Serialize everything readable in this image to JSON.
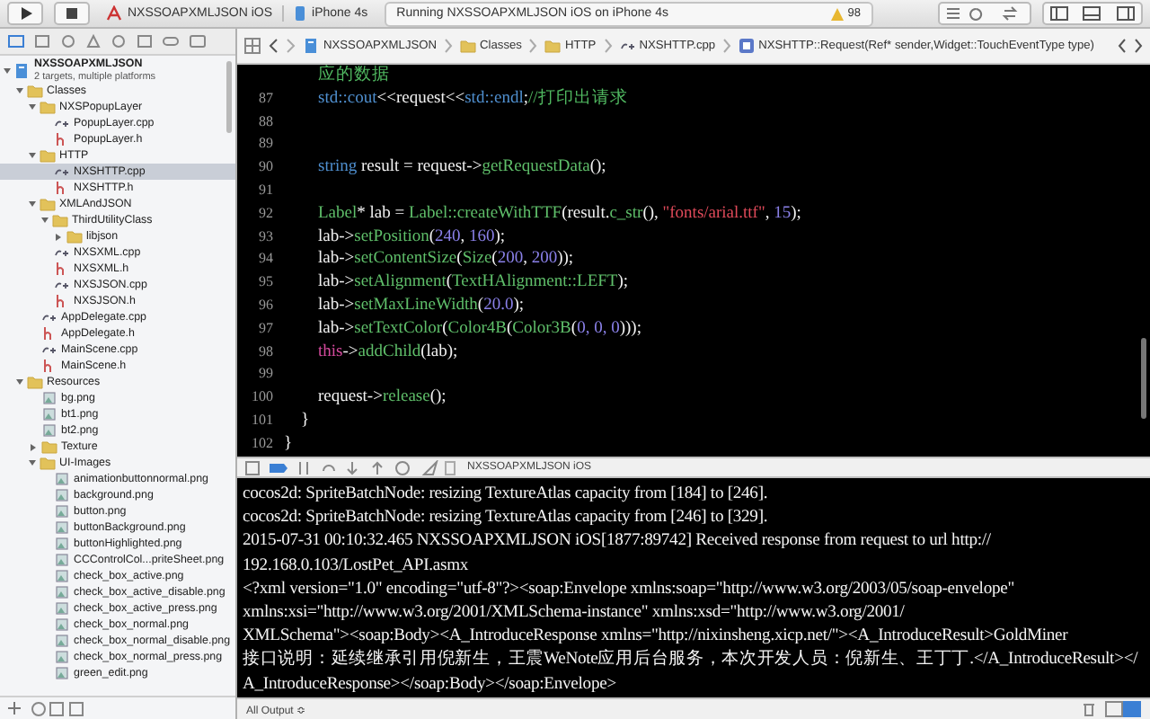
{
  "toolbar": {
    "scheme": "NXSSOAPXMLJSON iOS",
    "device": "iPhone 4s",
    "status": "Running NXSSOAPXMLJSON iOS on iPhone 4s",
    "warnings": "98"
  },
  "navigator": {
    "tree": [
      {
        "label": "NXSSOAPXMLJSON",
        "subtitle": "2 targets, multiple platforms",
        "kind": "project",
        "expanded": true,
        "selected": false,
        "children": [
          {
            "label": "Classes",
            "kind": "folder",
            "expanded": true,
            "selected": false,
            "children": [
              {
                "label": "NXSPopupLayer",
                "kind": "folder",
                "expanded": true,
                "selected": false,
                "children": [
                  {
                    "label": "PopupLayer.cpp",
                    "kind": "cpp",
                    "selected": false
                  },
                  {
                    "label": "PopupLayer.h",
                    "kind": "h",
                    "selected": false
                  }
                ]
              },
              {
                "label": "HTTP",
                "kind": "folder",
                "expanded": true,
                "selected": false,
                "children": [
                  {
                    "label": "NXSHTTP.cpp",
                    "kind": "cpp",
                    "selected": true
                  },
                  {
                    "label": "NXSHTTP.h",
                    "kind": "h",
                    "selected": false
                  }
                ]
              },
              {
                "label": "XMLAndJSON",
                "kind": "folder",
                "expanded": true,
                "selected": false,
                "children": [
                  {
                    "label": "ThirdUtilityClass",
                    "kind": "folder",
                    "expanded": true,
                    "selected": false,
                    "children": [
                      {
                        "label": "libjson",
                        "kind": "folder",
                        "expanded": false,
                        "selected": false
                      }
                    ]
                  },
                  {
                    "label": "NXSXML.cpp",
                    "kind": "cpp",
                    "selected": false
                  },
                  {
                    "label": "NXSXML.h",
                    "kind": "h",
                    "selected": false
                  },
                  {
                    "label": "NXSJSON.cpp",
                    "kind": "cpp",
                    "selected": false
                  },
                  {
                    "label": "NXSJSON.h",
                    "kind": "h",
                    "selected": false
                  }
                ]
              },
              {
                "label": "AppDelegate.cpp",
                "kind": "cpp",
                "selected": false
              },
              {
                "label": "AppDelegate.h",
                "kind": "h",
                "selected": false
              },
              {
                "label": "MainScene.cpp",
                "kind": "cpp",
                "selected": false
              },
              {
                "label": "MainScene.h",
                "kind": "h",
                "selected": false
              }
            ]
          },
          {
            "label": "Resources",
            "kind": "folder",
            "expanded": true,
            "selected": false,
            "children": [
              {
                "label": "bg.png",
                "kind": "png",
                "selected": false
              },
              {
                "label": "bt1.png",
                "kind": "png",
                "selected": false
              },
              {
                "label": "bt2.png",
                "kind": "png",
                "selected": false
              },
              {
                "label": "Texture",
                "kind": "folder",
                "expanded": false,
                "selected": false
              },
              {
                "label": "UI-Images",
                "kind": "folder",
                "expanded": true,
                "selected": false,
                "children": [
                  {
                    "label": "animationbuttonnormal.png",
                    "kind": "png",
                    "selected": false
                  },
                  {
                    "label": "background.png",
                    "kind": "png",
                    "selected": false
                  },
                  {
                    "label": "button.png",
                    "kind": "png",
                    "selected": false
                  },
                  {
                    "label": "buttonBackground.png",
                    "kind": "png",
                    "selected": false
                  },
                  {
                    "label": "buttonHighlighted.png",
                    "kind": "png",
                    "selected": false
                  },
                  {
                    "label": "CCControlCol...priteSheet.png",
                    "kind": "png",
                    "selected": false
                  },
                  {
                    "label": "check_box_active.png",
                    "kind": "png",
                    "selected": false
                  },
                  {
                    "label": "check_box_active_disable.png",
                    "kind": "png",
                    "selected": false
                  },
                  {
                    "label": "check_box_active_press.png",
                    "kind": "png",
                    "selected": false
                  },
                  {
                    "label": "check_box_normal.png",
                    "kind": "png",
                    "selected": false
                  },
                  {
                    "label": "check_box_normal_disable.png",
                    "kind": "png",
                    "selected": false
                  },
                  {
                    "label": "check_box_normal_press.png",
                    "kind": "png",
                    "selected": false
                  },
                  {
                    "label": "green_edit.png",
                    "kind": "png",
                    "selected": false
                  }
                ]
              }
            ]
          }
        ]
      }
    ]
  },
  "breadcrumbs": [
    {
      "label": "NXSSOAPXMLJSON",
      "kind": "project"
    },
    {
      "label": "Classes",
      "kind": "folder"
    },
    {
      "label": "HTTP",
      "kind": "folder"
    },
    {
      "label": "NXSHTTP.cpp",
      "kind": "cpp"
    },
    {
      "label": "NXSHTTP::Request(Ref* sender,Widget::TouchEventType type)",
      "kind": "method"
    }
  ],
  "editor": {
    "lines": [
      {
        "tokens": [
          {
            "kind": "comment",
            "text": "        应的数据"
          }
        ]
      },
      {
        "number": "87",
        "tokens": [
          {
            "kind": "type",
            "text": "        std::cout"
          },
          {
            "kind": "plain",
            "text": "<<request<<"
          },
          {
            "kind": "type",
            "text": "std::endl"
          },
          {
            "kind": "plain",
            "text": ";"
          },
          {
            "kind": "comment",
            "text": "//打印出请求"
          }
        ]
      },
      {
        "number": "88"
      },
      {
        "number": "89"
      },
      {
        "number": "90",
        "tokens": [
          {
            "kind": "type",
            "text": "        string"
          },
          {
            "kind": "plain",
            "text": " result = request->"
          },
          {
            "kind": "fn",
            "text": "getRequestData"
          },
          {
            "kind": "plain",
            "text": "();"
          }
        ]
      },
      {
        "number": "91"
      },
      {
        "number": "92",
        "tokens": [
          {
            "kind": "fn",
            "text": "        Label"
          },
          {
            "kind": "plain",
            "text": "* lab = "
          },
          {
            "kind": "fn",
            "text": "Label::createWithTTF"
          },
          {
            "kind": "plain",
            "text": "(result."
          },
          {
            "kind": "fn",
            "text": "c_str"
          },
          {
            "kind": "plain",
            "text": "(), "
          },
          {
            "kind": "str",
            "text": "\"fonts/arial.ttf\""
          },
          {
            "kind": "plain",
            "text": ", "
          },
          {
            "kind": "num",
            "text": "15"
          },
          {
            "kind": "plain",
            "text": ");"
          }
        ]
      },
      {
        "number": "93",
        "tokens": [
          {
            "kind": "plain",
            "text": "        lab->"
          },
          {
            "kind": "fn",
            "text": "setPosition"
          },
          {
            "kind": "plain",
            "text": "("
          },
          {
            "kind": "num",
            "text": "240"
          },
          {
            "kind": "plain",
            "text": ", "
          },
          {
            "kind": "num",
            "text": "160"
          },
          {
            "kind": "plain",
            "text": ");"
          }
        ]
      },
      {
        "number": "94",
        "tokens": [
          {
            "kind": "plain",
            "text": "        lab->"
          },
          {
            "kind": "fn",
            "text": "setContentSize"
          },
          {
            "kind": "plain",
            "text": "("
          },
          {
            "kind": "fn",
            "text": "Size"
          },
          {
            "kind": "plain",
            "text": "("
          },
          {
            "kind": "num",
            "text": "200"
          },
          {
            "kind": "plain",
            "text": ", "
          },
          {
            "kind": "num",
            "text": "200"
          },
          {
            "kind": "plain",
            "text": "));"
          }
        ]
      },
      {
        "number": "95",
        "tokens": [
          {
            "kind": "plain",
            "text": "        lab->"
          },
          {
            "kind": "fn",
            "text": "setAlignment"
          },
          {
            "kind": "plain",
            "text": "("
          },
          {
            "kind": "fn",
            "text": "TextHAlignment::LEFT"
          },
          {
            "kind": "plain",
            "text": ");"
          }
        ]
      },
      {
        "number": "96",
        "tokens": [
          {
            "kind": "plain",
            "text": "        lab->"
          },
          {
            "kind": "fn",
            "text": "setMaxLineWidth"
          },
          {
            "kind": "plain",
            "text": "("
          },
          {
            "kind": "num",
            "text": "20.0"
          },
          {
            "kind": "plain",
            "text": ");"
          }
        ]
      },
      {
        "number": "97",
        "tokens": [
          {
            "kind": "plain",
            "text": "        lab->"
          },
          {
            "kind": "fn",
            "text": "setTextColor"
          },
          {
            "kind": "plain",
            "text": "("
          },
          {
            "kind": "fn",
            "text": "Color4B"
          },
          {
            "kind": "plain",
            "text": "("
          },
          {
            "kind": "fn",
            "text": "Color3B"
          },
          {
            "kind": "plain",
            "text": "("
          },
          {
            "kind": "num",
            "text": "0, 0, 0"
          },
          {
            "kind": "plain",
            "text": ")));"
          }
        ]
      },
      {
        "number": "98",
        "tokens": [
          {
            "kind": "kw",
            "text": "        this"
          },
          {
            "kind": "plain",
            "text": "->"
          },
          {
            "kind": "fn",
            "text": "addChild"
          },
          {
            "kind": "plain",
            "text": "(lab);"
          }
        ]
      },
      {
        "number": "99"
      },
      {
        "number": "100",
        "tokens": [
          {
            "kind": "plain",
            "text": "        request->"
          },
          {
            "kind": "fn",
            "text": "release"
          },
          {
            "kind": "plain",
            "text": "();"
          }
        ]
      },
      {
        "number": "101",
        "tokens": [
          {
            "kind": "plain",
            "text": "    }"
          }
        ]
      },
      {
        "number": "102",
        "tokens": [
          {
            "kind": "plain",
            "text": "}"
          }
        ]
      }
    ]
  },
  "debug_bar": {
    "target": "NXSSOAPXMLJSON iOS"
  },
  "console": {
    "lines": [
      "cocos2d: SpriteBatchNode: resizing TextureAtlas capacity from [184] to [246].",
      "cocos2d: SpriteBatchNode: resizing TextureAtlas capacity from [246] to [329].",
      "2015-07-31 00:10:32.465 NXSSOAPXMLJSON iOS[1877:89742] Received response from request to url http://",
      "192.168.0.103/LostPet_API.asmx",
      "<?xml version=\"1.0\" encoding=\"utf-8\"?><soap:Envelope xmlns:soap=\"http://www.w3.org/2003/05/soap-envelope\"",
      "xmlns:xsi=\"http://www.w3.org/2001/XMLSchema-instance\" xmlns:xsd=\"http://www.w3.org/2001/",
      "XMLSchema\"><soap:Body><A_IntroduceResponse xmlns=\"http://nixinsheng.xicp.net/\"><A_IntroduceResult>GoldMiner",
      "接口说明：延续继承引用倪新生，王震WeNote应用后台服务，本次开发人员：倪新生、王丁丁.</A_IntroduceResult></",
      "A_IntroduceResponse></soap:Body></soap:Envelope>"
    ]
  },
  "footer": {
    "filter": "All Output ≎"
  }
}
